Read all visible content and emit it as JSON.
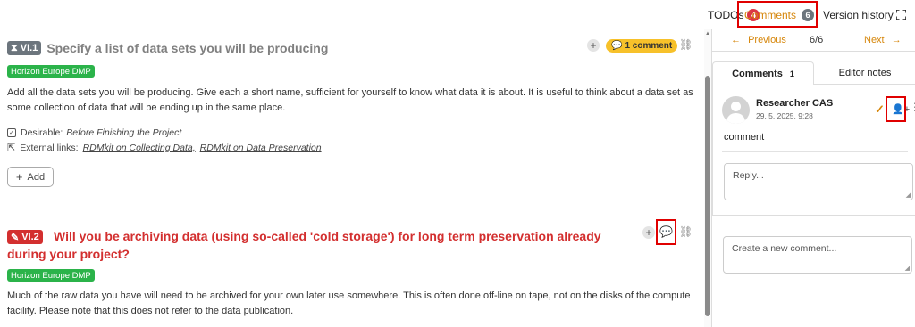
{
  "topbar": {
    "todos_label": "TODOs",
    "todos_count": "4",
    "comments_label": "Comments",
    "comments_count": "6",
    "version_history_label": "Version history",
    "fullscreen_icon": "expand-icon"
  },
  "questions": [
    {
      "number": "VI.1",
      "status_icon": "hourglass-icon",
      "title": "Specify a list of data sets you will be producing",
      "tag": "Horizon Europe DMP",
      "description": "Add all the data sets you will be producing. Give each a short name, sufficient for yourself to know what data it is about. It is useful to think about a data set as some collection of data that will be ending up in the same place.",
      "desirable_label": "Desirable:",
      "desirable_value": "Before Finishing the Project",
      "external_links_label": "External links:",
      "links": [
        "RDMkit on Collecting Data,",
        "RDMkit on Data Preservation"
      ],
      "add_label": "Add",
      "comment_pill": "1 comment"
    },
    {
      "number": "VI.2",
      "status_icon": "pencil-icon",
      "title": "Will you be archiving data (using so-called 'cold storage') for long term preservation already during your project?",
      "tag": "Horizon Europe DMP",
      "description": "Much of the raw data you have will need to be archived for your own later use somewhere. This is often done off-line on tape, not on the disks of the compute facility. Please note that this does not refer to the data publication."
    }
  ],
  "panel": {
    "prev_label": "Previous",
    "position": "6/6",
    "next_label": "Next",
    "tab_comments_label": "Comments",
    "tab_comments_count": "1",
    "tab_editor_notes_label": "Editor notes",
    "author": "Researcher CAS",
    "date": "29. 5. 2025, 9:28",
    "comment_text": "comment",
    "reply_placeholder": "Reply...",
    "new_comment_placeholder": "Create a new comment..."
  },
  "colors": {
    "accent": "#d6860a",
    "danger": "#d32f2f",
    "tag_green": "#2bb34a",
    "pill_yellow": "#f7c12a",
    "highlight_box": "#e00000"
  }
}
